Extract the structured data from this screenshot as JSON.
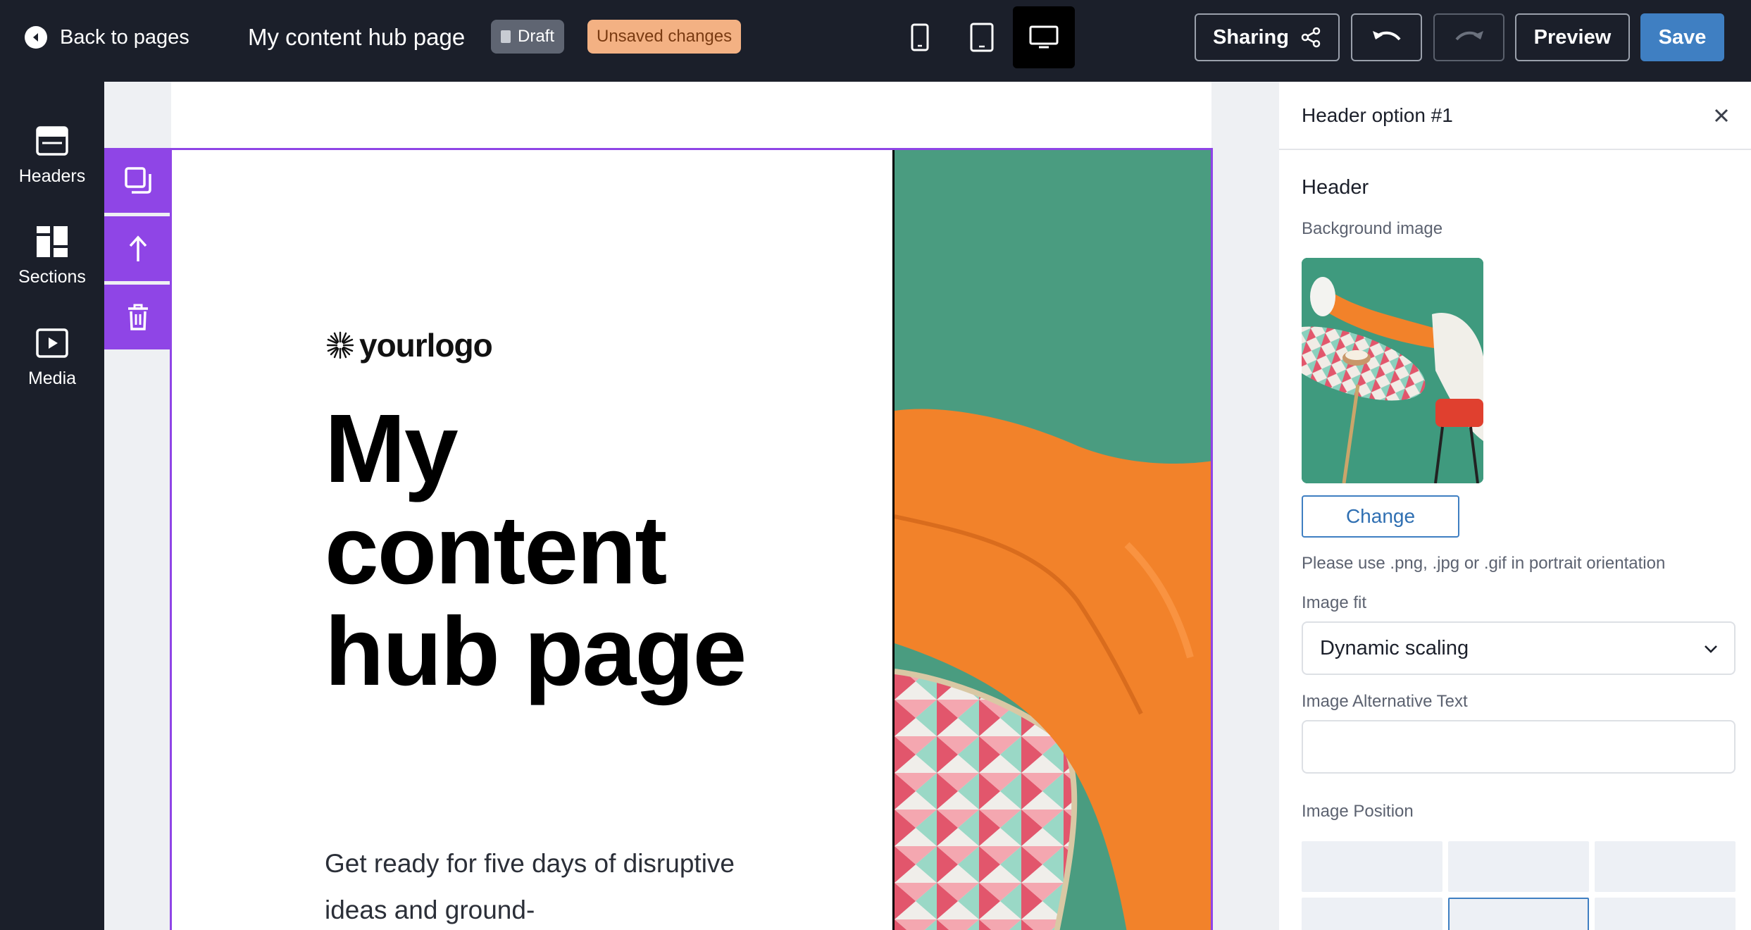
{
  "topbar": {
    "back_label": "Back to pages",
    "page_title": "My content hub page",
    "draft_badge": "Draft",
    "unsaved_badge": "Unsaved changes",
    "devices": [
      "mobile-icon",
      "tablet-icon",
      "desktop-icon"
    ],
    "active_device": "desktop",
    "sharing_label": "Sharing",
    "preview_label": "Preview",
    "save_label": "Save"
  },
  "sidebar": {
    "items": [
      {
        "label": "Headers",
        "icon": "headers-icon"
      },
      {
        "label": "Sections",
        "icon": "sections-icon"
      },
      {
        "label": "Media",
        "icon": "media-icon"
      }
    ]
  },
  "canvas": {
    "logo_text": "yourlogo",
    "hero_title": "My content hub page",
    "hero_subtitle": "Get ready for five days of disruptive ideas and ground-"
  },
  "toolbar": {
    "tools": [
      "duplicate-icon",
      "move-up-icon",
      "delete-icon"
    ]
  },
  "panel": {
    "title": "Header option #1",
    "section_title": "Header",
    "bg_image_label": "Background image",
    "change_label": "Change",
    "format_hint": "Please use .png, .jpg or .gif in portrait orientation",
    "image_fit_label": "Image fit",
    "image_fit_value": "Dynamic scaling",
    "alt_text_label": "Image Alternative Text",
    "alt_text_value": "",
    "position_label": "Image Position",
    "selected_position": "top-center"
  },
  "colors": {
    "topbar_bg": "#1b1f2a",
    "accent_purple": "#8f45e6",
    "save_blue": "#3f7fc2",
    "unsaved_orange": "#f3b183",
    "hero_green": "#4a9c80",
    "legs_orange": "#f2822a"
  }
}
